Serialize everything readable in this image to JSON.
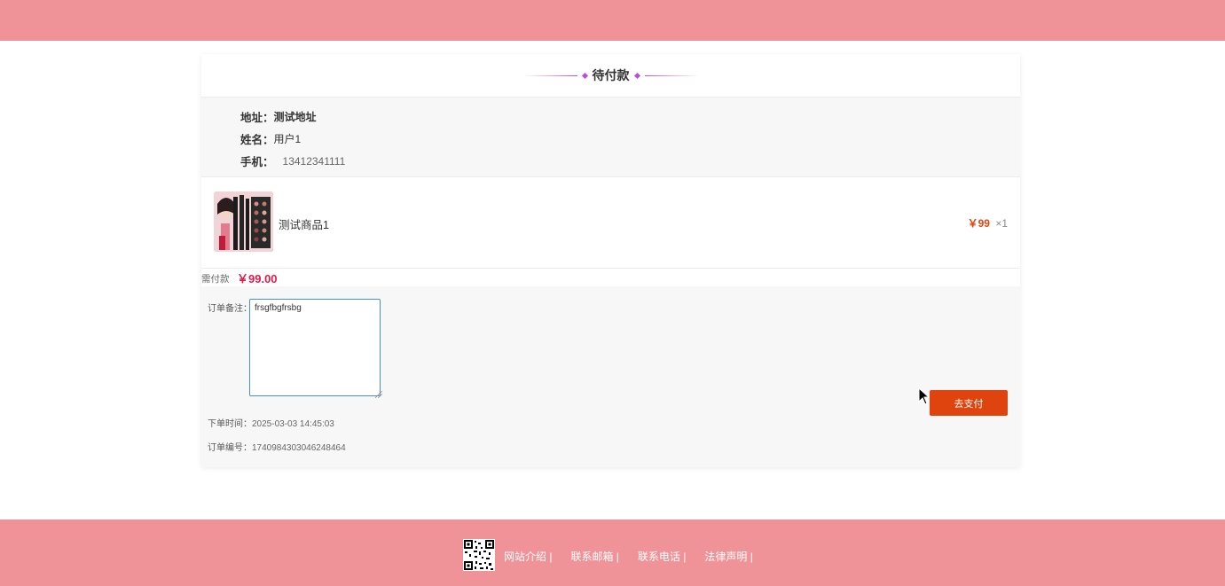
{
  "order": {
    "status_title": "待付款",
    "address_label": "地址：",
    "address_value": "测试地址",
    "name_label": "姓名：",
    "name_value": "用户1",
    "phone_label": "手机：",
    "phone_value": "13412341111"
  },
  "items": [
    {
      "name": "测试商品1",
      "price": "￥99",
      "quantity": "×1"
    }
  ],
  "payment": {
    "label": "需付款",
    "amount": "￥99.00"
  },
  "remark": {
    "label": "订单备注：",
    "value": "frsgfbgfrsbg"
  },
  "meta": {
    "time_label": "下单时间：",
    "time_value": "2025-03-03 14:45:03",
    "number_label": "订单编号：",
    "number_value": "1740984303046248464"
  },
  "actions": {
    "pay_button": "去支付"
  },
  "footer": {
    "links": [
      "网站介绍 |",
      "联系邮箱 |",
      "联系电话 |",
      "法律声明 |"
    ]
  },
  "colors": {
    "header_footer": "#f09399",
    "accent": "#e0440e",
    "price_highlight": "#e6194b"
  }
}
